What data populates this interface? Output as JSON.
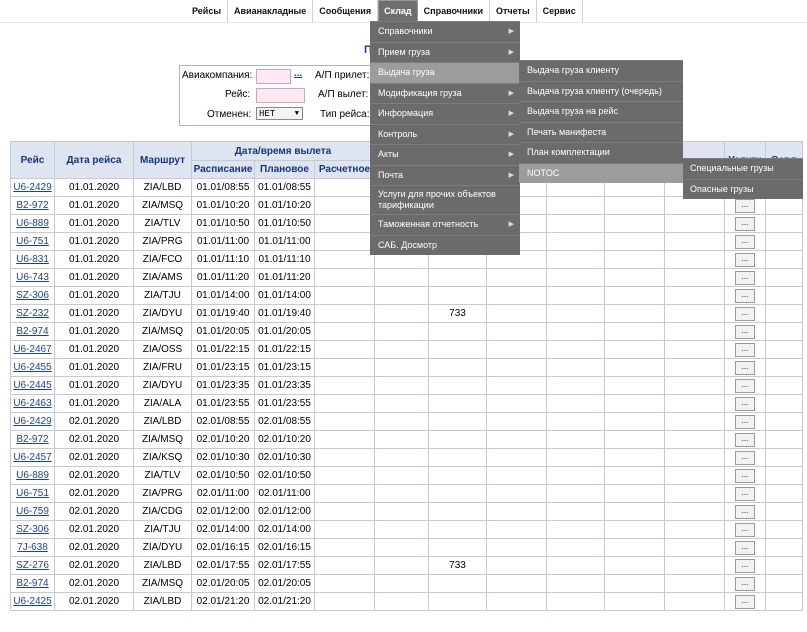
{
  "nav": {
    "items": [
      "Рейсы",
      "Авианакладные",
      "Сообщения",
      "Склад",
      "Справочники",
      "Отчеты",
      "Сервис"
    ],
    "active": "Склад"
  },
  "page_title": "П",
  "filters": {
    "airline_label": "Авиакомпания:",
    "airline_lookup": "...",
    "flight_label": "Рейс:",
    "cancelled_label": "Отменен:",
    "cancelled_value": "НЕТ",
    "ap_arrival_label": "А/П прилет:",
    "ap_departure_label": "А/П вылет:",
    "flight_type_label": "Тип рейса:"
  },
  "table": {
    "headers": {
      "flight": "Рейс",
      "date": "Дата рейса",
      "route": "Маршрут",
      "departure_group": "Дата/время вылета",
      "schedule": "Расписание",
      "planned": "Плановое",
      "estimated": "Расчетное",
      "services": "Услуги",
      "right_cut": "Ост.п"
    },
    "service_button": "...",
    "rows": [
      {
        "flight": "U6-2429",
        "date": "01.01.2020",
        "route": "ZIA/LBD",
        "sched": "01.01/08:55",
        "plan": "01.01/08:55",
        "count": ""
      },
      {
        "flight": "B2-972",
        "date": "01.01.2020",
        "route": "ZIA/MSQ",
        "sched": "01.01/10:20",
        "plan": "01.01/10:20",
        "count": ""
      },
      {
        "flight": "U6-889",
        "date": "01.01.2020",
        "route": "ZIA/TLV",
        "sched": "01.01/10:50",
        "plan": "01.01/10:50",
        "count": ""
      },
      {
        "flight": "U6-751",
        "date": "01.01.2020",
        "route": "ZIA/PRG",
        "sched": "01.01/11:00",
        "plan": "01.01/11:00",
        "count": ""
      },
      {
        "flight": "U6-831",
        "date": "01.01.2020",
        "route": "ZIA/FCO",
        "sched": "01.01/11:10",
        "plan": "01.01/11:10",
        "count": ""
      },
      {
        "flight": "U6-743",
        "date": "01.01.2020",
        "route": "ZIA/AMS",
        "sched": "01.01/11:20",
        "plan": "01.01/11:20",
        "count": ""
      },
      {
        "flight": "SZ-306",
        "date": "01.01.2020",
        "route": "ZIA/TJU",
        "sched": "01.01/14:00",
        "plan": "01.01/14:00",
        "count": ""
      },
      {
        "flight": "SZ-232",
        "date": "01.01.2020",
        "route": "ZIA/DYU",
        "sched": "01.01/19:40",
        "plan": "01.01/19:40",
        "count": "733"
      },
      {
        "flight": "B2-974",
        "date": "01.01.2020",
        "route": "ZIA/MSQ",
        "sched": "01.01/20:05",
        "plan": "01.01/20:05",
        "count": ""
      },
      {
        "flight": "U6-2467",
        "date": "01.01.2020",
        "route": "ZIA/OSS",
        "sched": "01.01/22:15",
        "plan": "01.01/22:15",
        "count": ""
      },
      {
        "flight": "U6-2455",
        "date": "01.01.2020",
        "route": "ZIA/FRU",
        "sched": "01.01/23:15",
        "plan": "01.01/23:15",
        "count": ""
      },
      {
        "flight": "U6-2445",
        "date": "01.01.2020",
        "route": "ZIA/DYU",
        "sched": "01.01/23:35",
        "plan": "01.01/23:35",
        "count": ""
      },
      {
        "flight": "U6-2463",
        "date": "01.01.2020",
        "route": "ZIA/ALA",
        "sched": "01.01/23:55",
        "plan": "01.01/23:55",
        "count": ""
      },
      {
        "flight": "U6-2429",
        "date": "02.01.2020",
        "route": "ZIA/LBD",
        "sched": "02.01/08:55",
        "plan": "02.01/08:55",
        "count": ""
      },
      {
        "flight": "B2-972",
        "date": "02.01.2020",
        "route": "ZIA/MSQ",
        "sched": "02.01/10:20",
        "plan": "02.01/10:20",
        "count": ""
      },
      {
        "flight": "U6-2457",
        "date": "02.01.2020",
        "route": "ZIA/KSQ",
        "sched": "02.01/10:30",
        "plan": "02.01/10:30",
        "count": ""
      },
      {
        "flight": "U6-889",
        "date": "02.01.2020",
        "route": "ZIA/TLV",
        "sched": "02.01/10:50",
        "plan": "02.01/10:50",
        "count": ""
      },
      {
        "flight": "U6-751",
        "date": "02.01.2020",
        "route": "ZIA/PRG",
        "sched": "02.01/11:00",
        "plan": "02.01/11:00",
        "count": ""
      },
      {
        "flight": "U6-759",
        "date": "02.01.2020",
        "route": "ZIA/CDG",
        "sched": "02.01/12:00",
        "plan": "02.01/12:00",
        "count": ""
      },
      {
        "flight": "SZ-306",
        "date": "02.01.2020",
        "route": "ZIA/TJU",
        "sched": "02.01/14:00",
        "plan": "02.01/14:00",
        "count": ""
      },
      {
        "flight": "7J-638",
        "date": "02.01.2020",
        "route": "ZIA/DYU",
        "sched": "02.01/16:15",
        "plan": "02.01/16:15",
        "count": ""
      },
      {
        "flight": "SZ-276",
        "date": "02.01.2020",
        "route": "ZIA/LBD",
        "sched": "02.01/17:55",
        "plan": "02.01/17:55",
        "count": "733"
      },
      {
        "flight": "B2-974",
        "date": "02.01.2020",
        "route": "ZIA/MSQ",
        "sched": "02.01/20:05",
        "plan": "02.01/20:05",
        "count": ""
      },
      {
        "flight": "U6-2425",
        "date": "02.01.2020",
        "route": "ZIA/LBD",
        "sched": "02.01/21:20",
        "plan": "02.01/21:20",
        "count": ""
      }
    ]
  },
  "menu": {
    "items": [
      {
        "label": "Справочники",
        "arrow": true
      },
      {
        "label": "Прием груза",
        "arrow": true
      },
      {
        "label": "Выдача груза",
        "arrow": false
      },
      {
        "label": "Модификация груза",
        "arrow": true
      },
      {
        "label": "Информация",
        "arrow": true
      },
      {
        "label": "Контроль",
        "arrow": true
      },
      {
        "label": "Акты",
        "arrow": true
      },
      {
        "label": "Почта",
        "arrow": true
      },
      {
        "label": "Услуги для прочих объектов тарификации",
        "arrow": false
      },
      {
        "label": "Таможенная отчетность",
        "arrow": true
      },
      {
        "label": "САБ. Досмотр",
        "arrow": false
      }
    ],
    "highlighted_index": 2
  },
  "submenu": {
    "items": [
      "Выдача груза клиенту",
      "Выдача груза клиенту (очередь)",
      "Выдача груза на рейс",
      "Печать манифеста",
      "План комплектации",
      "NOTOC"
    ],
    "highlighted_index": 5
  },
  "submenu2": {
    "items": [
      "Специальные грузы",
      "Опасные грузы"
    ]
  },
  "colors": {
    "menu_bg": "#6b6b6b",
    "menu_highlight": "#9c9c9c",
    "header_bg": "#dfe4f1",
    "link": "#1a3fb0"
  }
}
